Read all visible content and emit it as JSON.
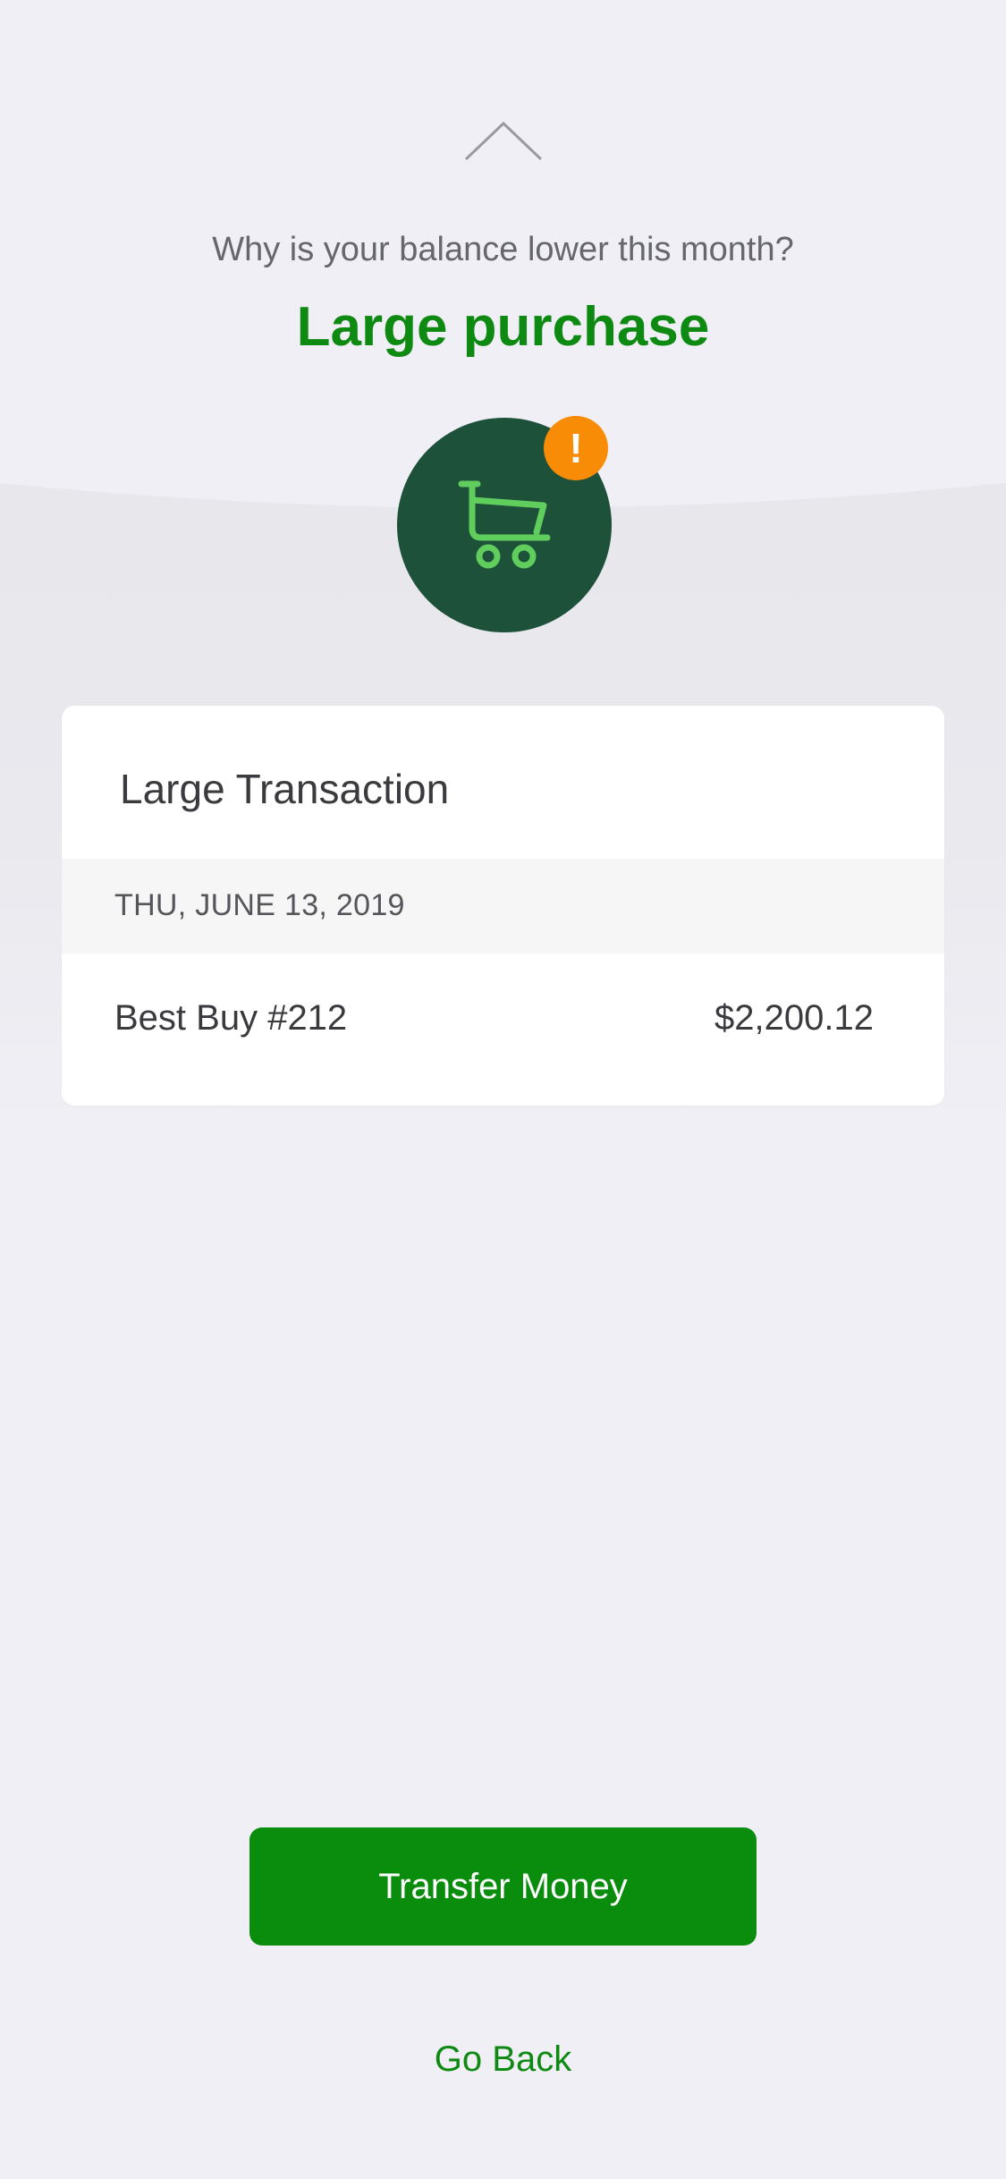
{
  "header": {
    "chevron_icon": "chevron-up-icon",
    "question": "Why is your balance lower this month?",
    "headline": "Large purchase"
  },
  "hero": {
    "icon": "shopping-cart-icon",
    "badge_text": "!",
    "circle_color": "#1d513a",
    "icon_color": "#5fce5c",
    "badge_color": "#f98c06"
  },
  "card": {
    "title": "Large Transaction",
    "date": "THU, JUNE 13, 2019",
    "transaction": {
      "merchant": "Best Buy #212",
      "amount": "$2,200.12"
    }
  },
  "actions": {
    "transfer_label": "Transfer Money",
    "go_back_label": "Go Back"
  },
  "colors": {
    "accent_green": "#0e8a12",
    "button_green": "#0a8c0c",
    "background": "#efeff5"
  }
}
